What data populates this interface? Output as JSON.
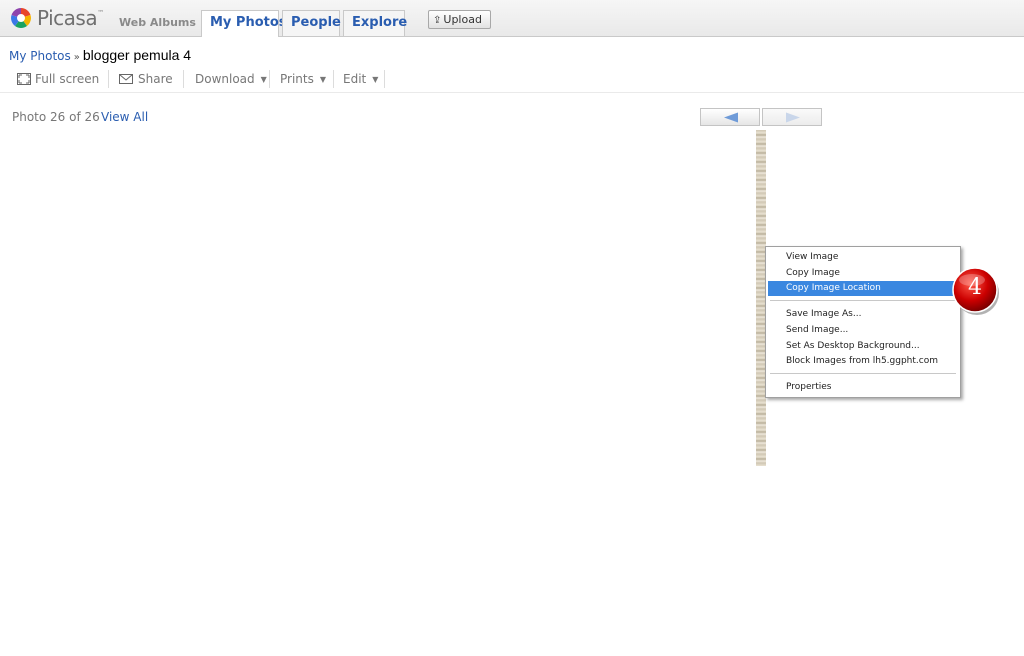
{
  "header": {
    "logo_word": "Picasa",
    "logo_tm": "™",
    "logo_sub": "Web Albums",
    "tabs": [
      {
        "label": "My Photos",
        "active": true
      },
      {
        "label": "People",
        "active": false
      },
      {
        "label": "Explore",
        "active": false
      }
    ],
    "upload_label": "Upload",
    "upload_icon": "upload-arrow-icon"
  },
  "breadcrumb": {
    "root": "My Photos",
    "separator": "»",
    "current": "blogger pemula 4"
  },
  "toolbar": {
    "full_screen": "Full screen",
    "share": "Share",
    "download": "Download",
    "prints": "Prints",
    "edit": "Edit"
  },
  "photo": {
    "count_text": "Photo 26 of 26",
    "view_all": "View All"
  },
  "context_menu": {
    "items": [
      "View Image",
      "Copy Image",
      "Copy Image Location",
      "Save Image As...",
      "Send Image...",
      "Set As Desktop Background...",
      "Block Images from lh5.ggpht.com",
      "Properties"
    ],
    "highlighted_index": 2
  },
  "annotation": {
    "step_number": "4",
    "color": "#cc0000"
  },
  "colors": {
    "link": "#2a5db0",
    "highlight": "#3a87e0",
    "nav_arrow": "#6f9bd8"
  }
}
